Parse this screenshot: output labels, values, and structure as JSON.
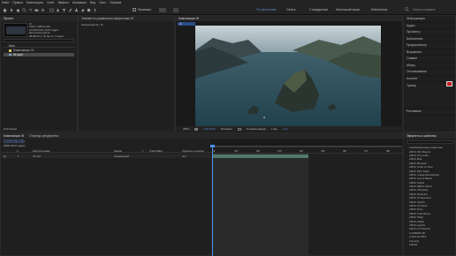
{
  "menu": [
    "Файл",
    "Правка",
    "Композиция",
    "Слой",
    "Эффект",
    "Анимация",
    "Вид",
    "Окно",
    "Справка"
  ],
  "toolbar": {
    "snap_label": "Привязка",
    "workspaces": [
      "По умолчанию",
      "Узнать",
      "Стандартные",
      "Маленький экран",
      "Библиотеки"
    ],
    "search_placeholder": "Поиск в справке"
  },
  "project": {
    "tab": "Проект",
    "controls_tab": "Элементы управления эффектами Ж",
    "thumb_info": [
      "Ж",
      "1920 x 1080 (1,00)",
      "Δ 0;00;10;00, 29,97 кадр/с",
      "Миллионы цветов",
      "48,000 кГц / 32 бит U / Стерео"
    ],
    "search_placeholder": "Поиск",
    "column_name": "Имя",
    "items": [
      {
        "name": "Композиция 01",
        "color": "#d6c45b"
      },
      {
        "name": "Ж.mp4",
        "color": "#7aa0c4",
        "selected": true
      }
    ],
    "bit_depth": "8 бит/канал"
  },
  "composition": {
    "tab": "Композиция Ж",
    "sub_tab": "Ж",
    "zoom": "(50%)",
    "timecode": "0;00;00;00",
    "quality": "Половина",
    "camera": "Активная камера",
    "views": "1 вид",
    "exposure": "+0,0"
  },
  "footage_tab": "Композиция 01 | Ж",
  "right_panel": {
    "items": [
      "Информация",
      "Аудио",
      "Просмотр",
      "Библиотеки",
      "Предпросмотр",
      "Выровнять",
      "Символ",
      "Абзац",
      "Отслеживание",
      "Контент",
      "Трекер",
      "Рисование"
    ],
    "swatch_color": "#c41a1a"
  },
  "effects_panel": {
    "title": "Эффекты и шаблоны",
    "search_placeholder": "",
    "items": [
      "Анимационные шаблоны",
      "BCC 3D Objects",
      "BCC Art Looks",
      "BCC Blur",
      "BCC Browser",
      "BCC Color & Tone",
      "BCC Film Style",
      "BCC Image Restoration",
      "BCC Key & Blend",
      "BCC Lights",
      "BCC Match Move",
      "BCC Obsolete",
      "BCC Particles",
      "BCC Perspective",
      "BCC Stylize",
      "BCC Textures",
      "BCC Time",
      "BCC Transitions",
      "BCC Warp",
      "BCC+Warp",
      "BCC+Lights",
      "Boris FX Mocha",
      "CINEMA 4D",
      "Channel Blur",
      "Keying",
      "Matte"
    ]
  },
  "timeline": {
    "tab": "Композиция Ж",
    "render_tab": "Очередь рендеринга",
    "timecode": "0;00;00;00",
    "frame_info": "00000 (29,97 кадр/с)",
    "columns": [
      "#",
      "Имя источника",
      "Режим",
      "T",
      "Track Matte",
      "Родитель и ссылка"
    ],
    "layers": [
      {
        "num": "1",
        "name": "Ж.mp4",
        "mode": "Нормальный",
        "parent": "Нет"
      }
    ],
    "ruler": [
      "0f",
      "01f",
      "02f",
      "03f",
      "04f",
      "05f",
      "06f",
      "07f",
      "08f"
    ]
  }
}
